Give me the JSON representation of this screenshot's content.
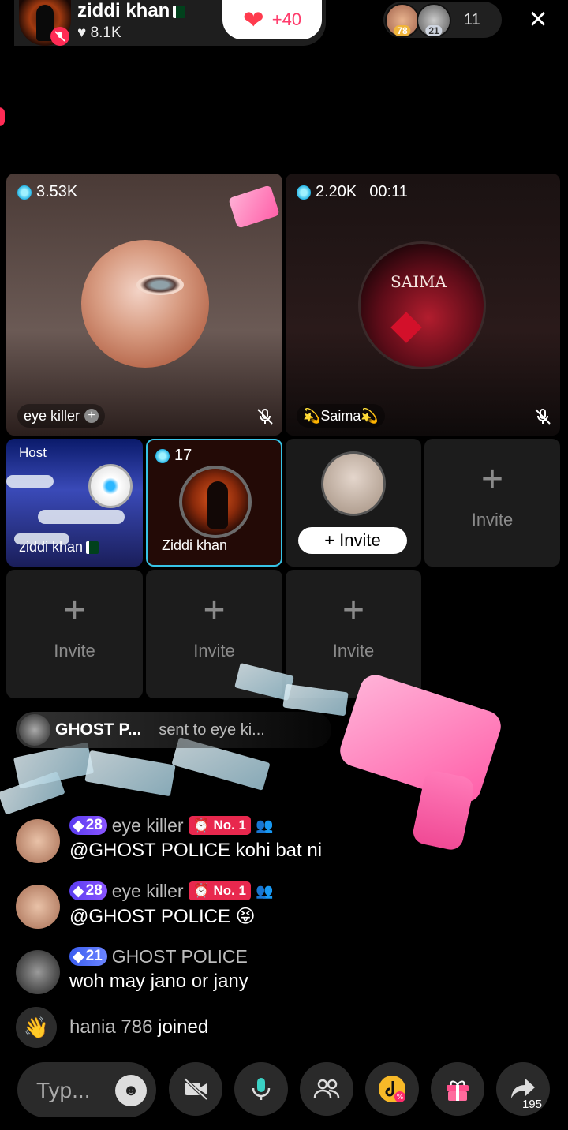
{
  "header": {
    "host_name": "ziddi khan",
    "host_likes": "8.1K",
    "like_increment": "+40",
    "viewer_badges": [
      "78",
      "21"
    ],
    "viewer_count": "11",
    "close_glyph": "×"
  },
  "guests": {
    "tile1": {
      "coins": "3.53K",
      "name": "eye killer"
    },
    "tile2": {
      "coins": "2.20K",
      "timer": "00:11",
      "name": "💫Saima💫",
      "avatar_text": "SAIMA"
    },
    "host_tile": {
      "tag": "Host",
      "name": "ziddi khan"
    },
    "ziddi_tile": {
      "coins": "17",
      "name": "Ziddi khan"
    },
    "invite_tile": {
      "button_label": "+ Invite"
    },
    "empty_tiles": [
      {
        "plus": "+",
        "label": "Invite"
      },
      {
        "plus": "+",
        "label": "Invite"
      },
      {
        "plus": "+",
        "label": "Invite"
      },
      {
        "plus": "+",
        "label": "Invite"
      }
    ]
  },
  "gift_banner": {
    "sender": "GHOST P...",
    "text": "sent to eye ki..."
  },
  "chat": [
    {
      "level": "28",
      "user": "eye killer",
      "rank": "No. 1",
      "message": "@GHOST POLICE kohi bat ni"
    },
    {
      "level": "28",
      "user": "eye killer",
      "rank": "No. 1",
      "message": "@GHOST POLICE 😝"
    },
    {
      "level": "21",
      "user": "GHOST POLICE",
      "message": "woh may jano or jany"
    }
  ],
  "join": {
    "user": "hania 786",
    "text": "joined"
  },
  "bottom_bar": {
    "comment_placeholder": "Typ...",
    "share_count": "195"
  },
  "colors": {
    "accent": "#ff2b55",
    "coin": "#23b4e6",
    "selected_border": "#37c3e6",
    "gift_pink": "#ff5ea8"
  }
}
